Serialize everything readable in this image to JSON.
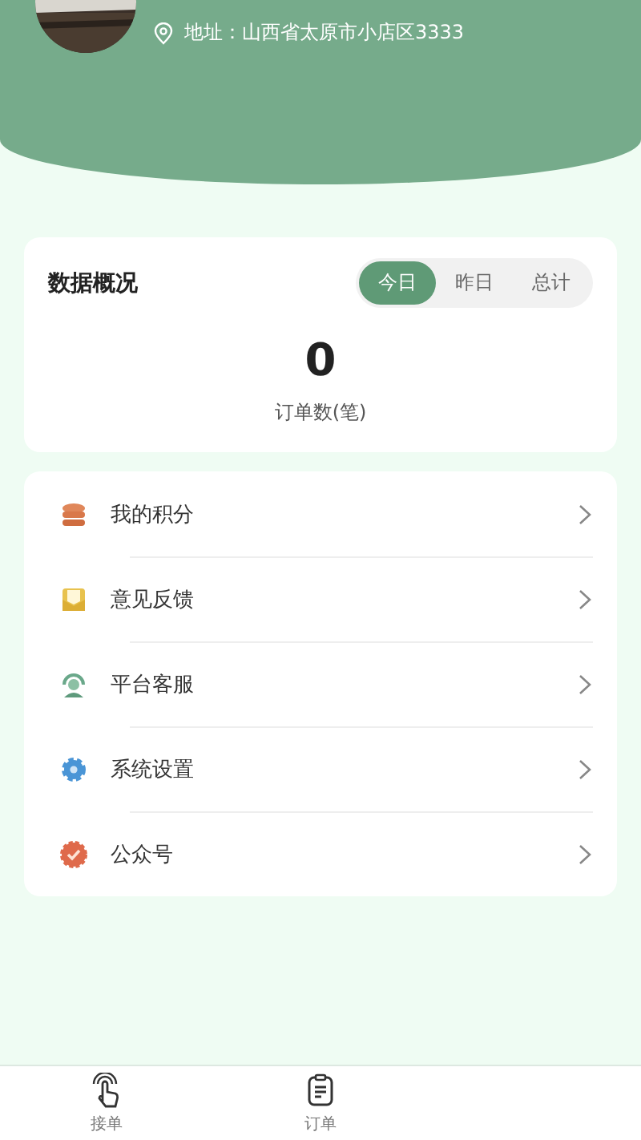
{
  "header": {
    "address": "地址：山西省太原市小店区3333"
  },
  "overview": {
    "title": "数据概况",
    "periods": [
      {
        "label": "今日",
        "selected": true
      },
      {
        "label": "昨日",
        "selected": false
      },
      {
        "label": "总计",
        "selected": false
      }
    ],
    "value": "0",
    "caption": "订单数(笔)"
  },
  "menu": [
    {
      "kind": "coins",
      "label": "我的积分"
    },
    {
      "kind": "mail",
      "label": "意见反馈"
    },
    {
      "kind": "headset",
      "label": "平台客服"
    },
    {
      "kind": "gear",
      "label": "系统设置"
    },
    {
      "kind": "badge",
      "label": "公众号"
    }
  ],
  "tab_bar": [
    {
      "kind": "hand",
      "label": "接单"
    },
    {
      "kind": "clipboard",
      "label": "订单"
    }
  ]
}
